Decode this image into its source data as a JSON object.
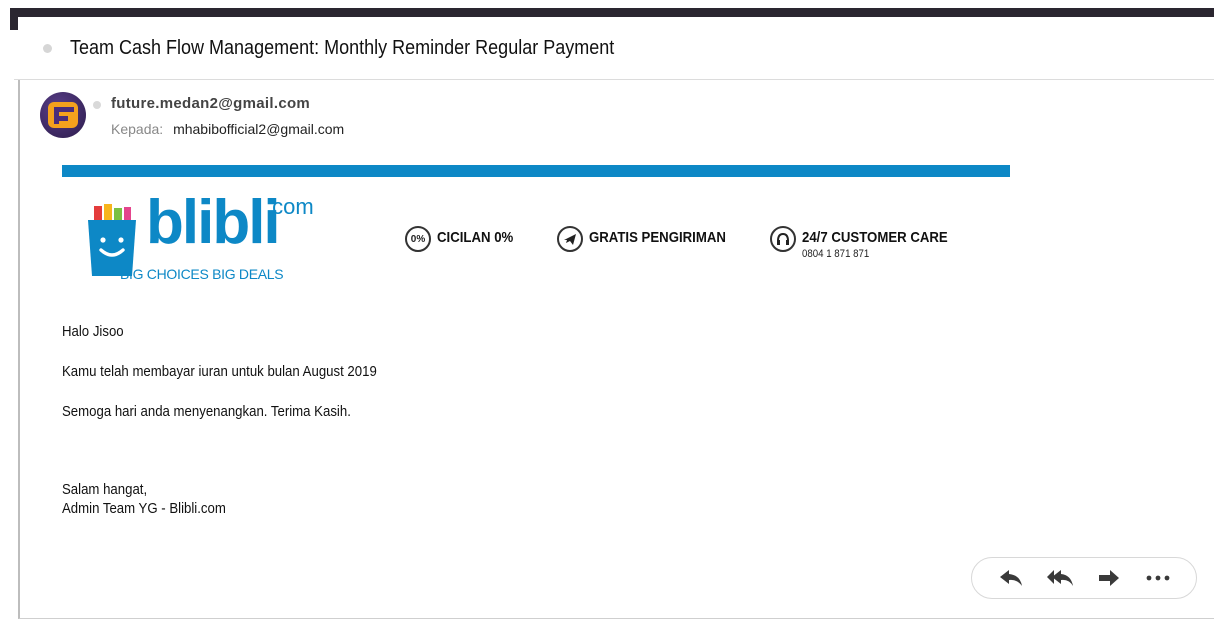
{
  "email": {
    "subject": "Team Cash Flow Management: Monthly Reminder Regular Payment",
    "sender": "future.medan2@gmail.com",
    "to_label": "Kepada:",
    "to_value": "mhabibofficial2@gmail.com",
    "avatar_initial": "F"
  },
  "banner": {
    "logo_word": "blibli",
    "logo_suffix": ".com",
    "tagline": "BIG CHOICES  BIG DEALS",
    "features": [
      {
        "icon_text": "0%",
        "label": "CICILAN 0%",
        "sub": ""
      },
      {
        "icon_text": "",
        "label": "GRATIS PENGIRIMAN",
        "sub": ""
      },
      {
        "icon_text": "",
        "label": "24/7 CUSTOMER CARE",
        "sub": "0804 1 871 871"
      }
    ],
    "colors": {
      "brand_blue": "#0d88c6"
    }
  },
  "body": {
    "greeting": "Halo Jisoo",
    "line1": "Kamu telah membayar iuran untuk bulan August 2019",
    "line2": "Semoga hari anda menyenangkan. Terima Kasih.",
    "closing1": "Salam hangat,",
    "closing2": "Admin Team YG - Blibli.com"
  },
  "actions": {
    "icons": [
      "reply-icon",
      "reply-all-icon",
      "forward-icon",
      "more-icon"
    ]
  }
}
